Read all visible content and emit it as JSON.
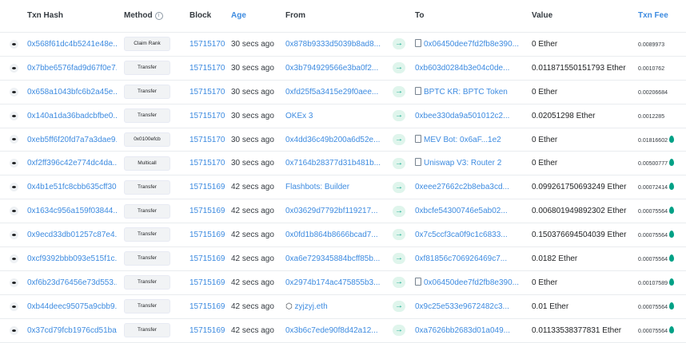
{
  "header": {
    "txn_hash": "Txn Hash",
    "method": "Method",
    "method_info": "i",
    "block": "Block",
    "age": "Age",
    "from": "From",
    "to": "To",
    "value": "Value",
    "txn_fee": "Txn Fee"
  },
  "colors": {
    "link": "#3d8be0",
    "arrow_bg": "#dff5ec",
    "arrow_fg": "#00a186"
  },
  "rows": [
    {
      "hash": "0x568f61dc4b5241e48e...",
      "method": "Claim Rank",
      "block": "15715170",
      "age": "30 secs ago",
      "from": "0x878b9333d5039b8ad8...",
      "from_link": true,
      "to": "0x06450dee7fd2fb8e390...",
      "to_link": true,
      "to_doc": true,
      "value": "0 Ether",
      "fee": "0.0089973",
      "flame": false
    },
    {
      "hash": "0x7bbe6576fad9d67f0e7...",
      "method": "Transfer",
      "block": "15715170",
      "age": "30 secs ago",
      "from": "0x3b794929566e3ba0f2...",
      "from_link": true,
      "to": "0xb603d0284b3e04c0de...",
      "to_link": true,
      "to_doc": false,
      "value": "0.011871550151793 Ether",
      "fee": "0.0010762",
      "flame": false
    },
    {
      "hash": "0x658a1043bfc6b2a45e...",
      "method": "Transfer",
      "block": "15715170",
      "age": "30 secs ago",
      "from": "0xfd25f5a3415e29f0aee...",
      "from_link": true,
      "to": "BPTC KR: BPTC Token",
      "to_link": true,
      "to_doc": true,
      "value": "0 Ether",
      "fee": "0.00206684",
      "flame": false
    },
    {
      "hash": "0x140a1da36badcbfbe0...",
      "method": "Transfer",
      "block": "15715170",
      "age": "30 secs ago",
      "from": "OKEx 3",
      "from_link": true,
      "to": "0xbee330da9a501012c2...",
      "to_link": true,
      "to_doc": false,
      "value": "0.02051298 Ether",
      "fee": "0.0012285",
      "flame": false
    },
    {
      "hash": "0xeb5ff6f20fd7a7a3dae9...",
      "method": "0x0100efcb",
      "block": "15715170",
      "age": "30 secs ago",
      "from": "0x4dd36c49b200a6d52e...",
      "from_link": true,
      "to": "MEV Bot: 0x6aF...1e2",
      "to_link": true,
      "to_doc": true,
      "value": "0 Ether",
      "fee": "0.01816602",
      "flame": true
    },
    {
      "hash": "0xf2ff396c42e774dc4da...",
      "method": "Multicall",
      "block": "15715170",
      "age": "30 secs ago",
      "from": "0x7164b28377d31b481b...",
      "from_link": true,
      "to": "Uniswap V3: Router 2",
      "to_link": true,
      "to_doc": true,
      "value": "0 Ether",
      "fee": "0.00500777",
      "flame": true
    },
    {
      "hash": "0x4b1e51fc8cbb635cff30...",
      "method": "Transfer",
      "block": "15715169",
      "age": "42 secs ago",
      "from": "Flashbots: Builder",
      "from_link": true,
      "to": "0xeee27662c2b8eba3cd...",
      "to_link": true,
      "to_doc": false,
      "value": "0.099261750693249 Ether",
      "fee": "0.00072414",
      "flame": true
    },
    {
      "hash": "0x1634c956a159f03844...",
      "method": "Transfer",
      "block": "15715169",
      "age": "42 secs ago",
      "from": "0x03629d7792bf119217...",
      "from_link": true,
      "to": "0xbcfe54300746e5ab02...",
      "to_link": true,
      "to_doc": false,
      "value": "0.006801949892302 Ether",
      "fee": "0.00075564",
      "flame": true
    },
    {
      "hash": "0x9ecd33db01257c87e4...",
      "method": "Transfer",
      "block": "15715169",
      "age": "42 secs ago",
      "from": "0x0fd1b864b8666bcad7...",
      "from_link": true,
      "to": "0x7c5ccf3ca0f9c1c6833...",
      "to_link": true,
      "to_doc": false,
      "value": "0.150376694504039 Ether",
      "fee": "0.00075564",
      "flame": true
    },
    {
      "hash": "0xcf9392bbb093e515f1c...",
      "method": "Transfer",
      "block": "15715169",
      "age": "42 secs ago",
      "from": "0xa6e729345884bcff85b...",
      "from_link": true,
      "to": "0xf81856c706926469c7...",
      "to_link": true,
      "to_doc": false,
      "value": "0.0182 Ether",
      "fee": "0.00075564",
      "flame": true
    },
    {
      "hash": "0xf6b23d76456e73d553...",
      "method": "Transfer",
      "block": "15715169",
      "age": "42 secs ago",
      "from": "0x2974b174ac475855b3...",
      "from_link": true,
      "to": "0x06450dee7fd2fb8e390...",
      "to_link": true,
      "to_doc": true,
      "value": "0 Ether",
      "fee": "0.00107589",
      "flame": true
    },
    {
      "hash": "0xb44deec95075a9cbb9...",
      "method": "Transfer",
      "block": "15715169",
      "age": "42 secs ago",
      "from": "zyjzyj.eth",
      "from_link": true,
      "from_ens": true,
      "to": "0x9c25e533e9672482c3...",
      "to_link": true,
      "to_doc": false,
      "value": "0.01 Ether",
      "fee": "0.00075564",
      "flame": true
    },
    {
      "hash": "0x37cd79fcb1976cd51ba...",
      "method": "Transfer",
      "block": "15715169",
      "age": "42 secs ago",
      "from": "0x3b6c7ede90f8d42a12...",
      "from_link": true,
      "to": "0xa7626bb2683d01a049...",
      "to_link": true,
      "to_doc": false,
      "value": "0.01133538377831 Ether",
      "fee": "0.00075564",
      "flame": true
    }
  ]
}
